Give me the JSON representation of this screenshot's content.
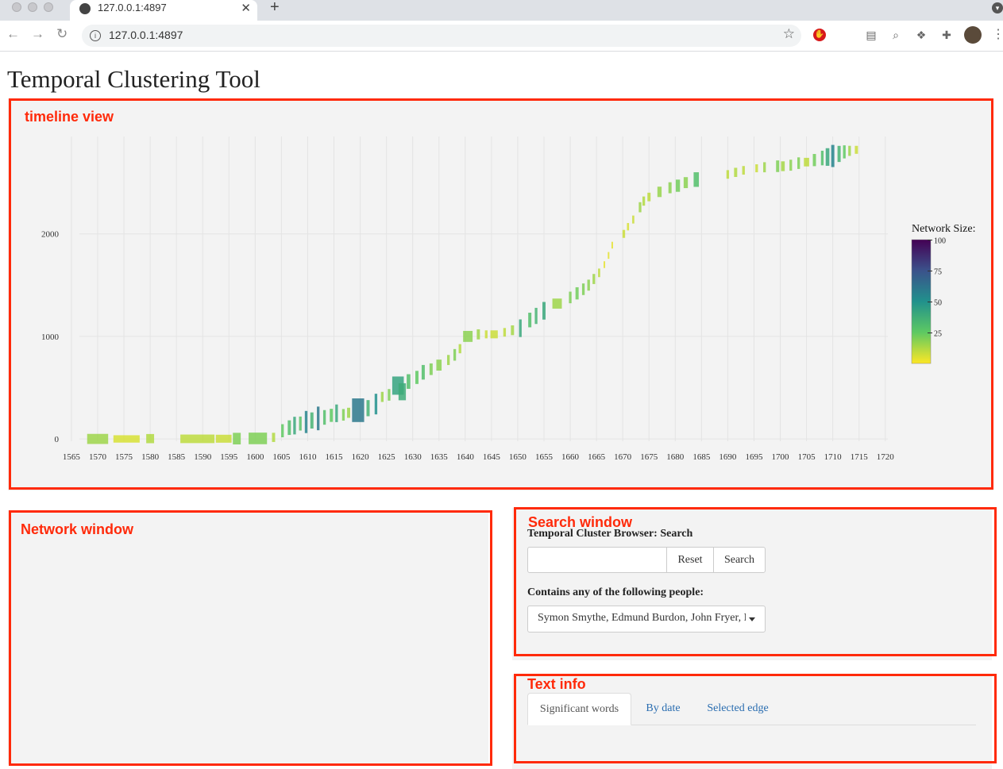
{
  "browser": {
    "tab_title": "127.0.0.1:4897",
    "url": "127.0.0.1:4897"
  },
  "page": {
    "title": "Temporal Clustering Tool"
  },
  "annotations": {
    "timeline": "timeline view",
    "network": "Network window",
    "search": "Search window",
    "textinfo": "Text info"
  },
  "chart_data": {
    "type": "scatter",
    "x_ticks": [
      "1565",
      "1570",
      "1575",
      "1580",
      "1585",
      "1590",
      "1595",
      "1600",
      "1605",
      "1610",
      "1615",
      "1620",
      "1625",
      "1630",
      "1635",
      "1640",
      "1645",
      "1650",
      "1655",
      "1660",
      "1665",
      "1670",
      "1675",
      "1680",
      "1685",
      "1690",
      "1695",
      "1700",
      "1705",
      "1710",
      "1715",
      "1720"
    ],
    "xlim": [
      1563.5,
      1722
    ],
    "y_ticks": [
      "0",
      "1000",
      "2000"
    ],
    "ylim": [
      -100,
      2950
    ],
    "grid": true,
    "legend": {
      "title": "Network Size:",
      "ticks": [
        "100",
        "75",
        "50",
        "25"
      ],
      "placement": "right",
      "colorscale": "viridis",
      "range": [
        0,
        100
      ]
    },
    "points": [
      {
        "x": 1570.0,
        "y": 0,
        "w": 4.0,
        "size": 15
      },
      {
        "x": 1575.5,
        "y": 0,
        "w": 5.0,
        "size": 6
      },
      {
        "x": 1580.0,
        "y": 3,
        "w": 1.5,
        "size": 12
      },
      {
        "x": 1589.0,
        "y": 1,
        "w": 6.5,
        "size": 10
      },
      {
        "x": 1594.0,
        "y": 2,
        "w": 3.0,
        "size": 8
      },
      {
        "x": 1596.5,
        "y": 3,
        "w": 1.5,
        "size": 20
      },
      {
        "x": 1600.5,
        "y": 5,
        "w": 3.5,
        "size": 20
      },
      {
        "x": 1603.5,
        "y": 15,
        "w": 0.6,
        "size": 12
      },
      {
        "x": 1605.2,
        "y": 80,
        "w": 0.5,
        "size": 25
      },
      {
        "x": 1606.5,
        "y": 110,
        "w": 0.6,
        "size": 30
      },
      {
        "x": 1607.5,
        "y": 130,
        "w": 0.5,
        "size": 40
      },
      {
        "x": 1608.6,
        "y": 150,
        "w": 0.5,
        "size": 28
      },
      {
        "x": 1609.7,
        "y": 165,
        "w": 0.5,
        "size": 55
      },
      {
        "x": 1610.8,
        "y": 180,
        "w": 0.6,
        "size": 35
      },
      {
        "x": 1612.0,
        "y": 200,
        "w": 0.5,
        "size": 60
      },
      {
        "x": 1613.2,
        "y": 210,
        "w": 0.5,
        "size": 30
      },
      {
        "x": 1614.5,
        "y": 230,
        "w": 0.6,
        "size": 25
      },
      {
        "x": 1615.5,
        "y": 250,
        "w": 0.5,
        "size": 40
      },
      {
        "x": 1616.8,
        "y": 235,
        "w": 0.5,
        "size": 20
      },
      {
        "x": 1617.8,
        "y": 255,
        "w": 0.6,
        "size": 15
      },
      {
        "x": 1619.6,
        "y": 280,
        "w": 2.3,
        "size": 60
      },
      {
        "x": 1621.5,
        "y": 300,
        "w": 0.6,
        "size": 35
      },
      {
        "x": 1623.0,
        "y": 340,
        "w": 0.5,
        "size": 50
      },
      {
        "x": 1624.2,
        "y": 410,
        "w": 0.5,
        "size": 15
      },
      {
        "x": 1625.5,
        "y": 430,
        "w": 0.5,
        "size": 20
      },
      {
        "x": 1627.2,
        "y": 520,
        "w": 2.2,
        "size": 42
      },
      {
        "x": 1628.0,
        "y": 460,
        "w": 1.4,
        "size": 38
      },
      {
        "x": 1629.2,
        "y": 560,
        "w": 0.7,
        "size": 30
      },
      {
        "x": 1630.8,
        "y": 600,
        "w": 0.6,
        "size": 25
      },
      {
        "x": 1632.0,
        "y": 650,
        "w": 0.6,
        "size": 30
      },
      {
        "x": 1633.5,
        "y": 680,
        "w": 0.6,
        "size": 20
      },
      {
        "x": 1635.0,
        "y": 720,
        "w": 1.0,
        "size": 18
      },
      {
        "x": 1636.8,
        "y": 770,
        "w": 0.5,
        "size": 15
      },
      {
        "x": 1638.0,
        "y": 820,
        "w": 0.5,
        "size": 20
      },
      {
        "x": 1639.0,
        "y": 880,
        "w": 0.5,
        "size": 12
      },
      {
        "x": 1640.5,
        "y": 1000,
        "w": 1.8,
        "size": 18
      },
      {
        "x": 1642.5,
        "y": 1020,
        "w": 0.6,
        "size": 15
      },
      {
        "x": 1644.0,
        "y": 1020,
        "w": 0.5,
        "size": 8
      },
      {
        "x": 1645.5,
        "y": 1020,
        "w": 1.4,
        "size": 8
      },
      {
        "x": 1647.5,
        "y": 1040,
        "w": 0.5,
        "size": 10
      },
      {
        "x": 1649.0,
        "y": 1060,
        "w": 0.6,
        "size": 14
      },
      {
        "x": 1650.5,
        "y": 1080,
        "w": 0.5,
        "size": 40
      },
      {
        "x": 1652.3,
        "y": 1160,
        "w": 0.6,
        "size": 30
      },
      {
        "x": 1653.5,
        "y": 1200,
        "w": 0.5,
        "size": 35
      },
      {
        "x": 1655.0,
        "y": 1250,
        "w": 0.6,
        "size": 40
      },
      {
        "x": 1657.5,
        "y": 1320,
        "w": 1.8,
        "size": 15
      },
      {
        "x": 1660.0,
        "y": 1380,
        "w": 0.5,
        "size": 20
      },
      {
        "x": 1661.3,
        "y": 1420,
        "w": 0.6,
        "size": 22
      },
      {
        "x": 1662.5,
        "y": 1460,
        "w": 0.5,
        "size": 20
      },
      {
        "x": 1663.5,
        "y": 1500,
        "w": 0.5,
        "size": 18
      },
      {
        "x": 1664.5,
        "y": 1560,
        "w": 0.5,
        "size": 15
      },
      {
        "x": 1665.5,
        "y": 1620,
        "w": 0.4,
        "size": 10
      },
      {
        "x": 1666.5,
        "y": 1700,
        "w": 0.3,
        "size": 4
      },
      {
        "x": 1667.3,
        "y": 1790,
        "w": 0.3,
        "size": 4
      },
      {
        "x": 1668.0,
        "y": 1890,
        "w": 0.3,
        "size": 4
      },
      {
        "x": 1670.2,
        "y": 2000,
        "w": 0.5,
        "size": 8
      },
      {
        "x": 1671.0,
        "y": 2070,
        "w": 0.4,
        "size": 6
      },
      {
        "x": 1672.0,
        "y": 2140,
        "w": 0.4,
        "size": 8
      },
      {
        "x": 1673.3,
        "y": 2260,
        "w": 0.5,
        "size": 15
      },
      {
        "x": 1674.0,
        "y": 2320,
        "w": 0.5,
        "size": 12
      },
      {
        "x": 1675.0,
        "y": 2360,
        "w": 0.6,
        "size": 10
      },
      {
        "x": 1677.0,
        "y": 2410,
        "w": 0.8,
        "size": 16
      },
      {
        "x": 1679.0,
        "y": 2450,
        "w": 0.6,
        "size": 18
      },
      {
        "x": 1680.5,
        "y": 2470,
        "w": 0.8,
        "size": 22
      },
      {
        "x": 1682.0,
        "y": 2500,
        "w": 0.8,
        "size": 18
      },
      {
        "x": 1684.0,
        "y": 2530,
        "w": 1.0,
        "size": 30
      },
      {
        "x": 1690.0,
        "y": 2580,
        "w": 0.5,
        "size": 10
      },
      {
        "x": 1691.5,
        "y": 2600,
        "w": 0.6,
        "size": 12
      },
      {
        "x": 1693.0,
        "y": 2620,
        "w": 0.5,
        "size": 10
      },
      {
        "x": 1695.5,
        "y": 2640,
        "w": 0.5,
        "size": 8
      },
      {
        "x": 1697.0,
        "y": 2650,
        "w": 0.5,
        "size": 15
      },
      {
        "x": 1699.5,
        "y": 2660,
        "w": 0.6,
        "size": 20
      },
      {
        "x": 1700.5,
        "y": 2660,
        "w": 0.7,
        "size": 14
      },
      {
        "x": 1702.0,
        "y": 2670,
        "w": 0.5,
        "size": 18
      },
      {
        "x": 1703.5,
        "y": 2690,
        "w": 0.5,
        "size": 20
      },
      {
        "x": 1705.0,
        "y": 2700,
        "w": 1.0,
        "size": 10
      },
      {
        "x": 1706.5,
        "y": 2720,
        "w": 0.6,
        "size": 22
      },
      {
        "x": 1708.0,
        "y": 2740,
        "w": 0.5,
        "size": 30
      },
      {
        "x": 1709.0,
        "y": 2750,
        "w": 0.7,
        "size": 40
      },
      {
        "x": 1710.0,
        "y": 2760,
        "w": 0.6,
        "size": 55
      },
      {
        "x": 1711.2,
        "y": 2780,
        "w": 0.6,
        "size": 35
      },
      {
        "x": 1712.2,
        "y": 2800,
        "w": 0.5,
        "size": 25
      },
      {
        "x": 1713.2,
        "y": 2810,
        "w": 0.5,
        "size": 15
      },
      {
        "x": 1714.5,
        "y": 2820,
        "w": 0.6,
        "size": 8
      }
    ]
  },
  "search": {
    "heading": "Temporal Cluster Browser: Search",
    "input_value": "",
    "reset_label": "Reset",
    "search_label": "Search",
    "people_label": "Contains any of the following people:",
    "people_selected": "Symon Smythe, Edmund Burdon, John Fryer, Richard"
  },
  "textinfo": {
    "tabs": [
      "Significant words",
      "By date",
      "Selected edge"
    ]
  },
  "colors": {
    "annotation": "#ff2a0a",
    "panel_bg": "#f3f3f3",
    "link": "#2a6db0"
  }
}
